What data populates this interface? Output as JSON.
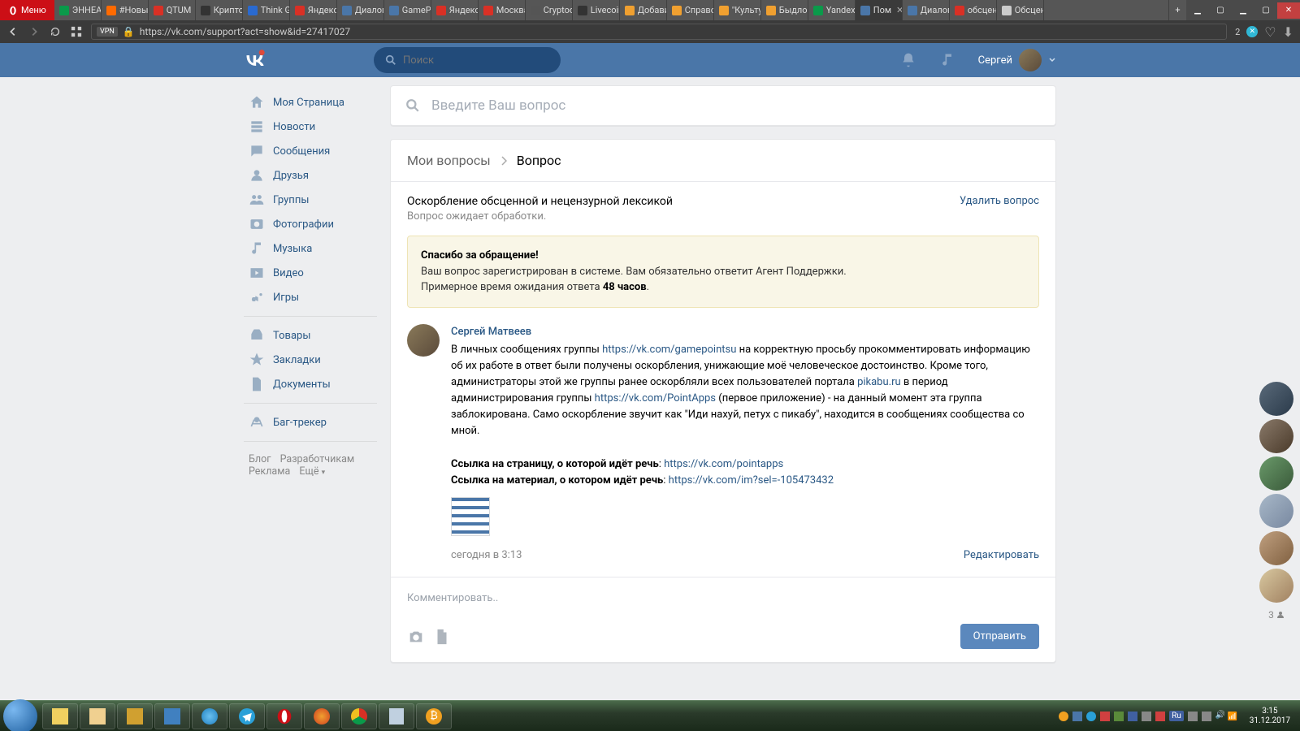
{
  "browser": {
    "menu_label": "Меню",
    "url": "https://vk.com/support?act=show&id=27417027",
    "vpn": "VPN",
    "ext_count": "2",
    "tabs": [
      {
        "label": "ЭННЕА",
        "fav": "#0a9a4a"
      },
      {
        "label": "#Новый",
        "fav": "#ff6a00"
      },
      {
        "label": "QTUM",
        "fav": "#d93025"
      },
      {
        "label": "Крипто",
        "fav": "#333"
      },
      {
        "label": "Think G",
        "fav": "#2a6ad0"
      },
      {
        "label": "Яндекс",
        "fav": "#d93025"
      },
      {
        "label": "Диалог",
        "fav": "#4a76a8"
      },
      {
        "label": "GamePo",
        "fav": "#4a76a8"
      },
      {
        "label": "Яндекс",
        "fav": "#d93025"
      },
      {
        "label": "Москва",
        "fav": "#d93025"
      },
      {
        "label": "Cryptoc",
        "fav": "#555"
      },
      {
        "label": "Livecoin",
        "fav": "#333"
      },
      {
        "label": "Добави",
        "fav": "#f0a030"
      },
      {
        "label": "Справо",
        "fav": "#f0a030"
      },
      {
        "label": "\"Культу",
        "fav": "#f0a030"
      },
      {
        "label": "Быдло|",
        "fav": "#f0a030"
      },
      {
        "label": "Yandex",
        "fav": "#0a9a4a"
      },
      {
        "label": "Пом",
        "fav": "#4a76a8",
        "active": true
      },
      {
        "label": "Диалог",
        "fav": "#4a76a8"
      },
      {
        "label": "обсцен",
        "fav": "#d93025"
      },
      {
        "label": "Обсцен",
        "fav": "#ccc"
      }
    ]
  },
  "header": {
    "search_placeholder": "Поиск",
    "user_name": "Сергей"
  },
  "sidebar": {
    "items": [
      "Моя Страница",
      "Новости",
      "Сообщения",
      "Друзья",
      "Группы",
      "Фотографии",
      "Музыка",
      "Видео",
      "Игры"
    ],
    "items2": [
      "Товары",
      "Закладки",
      "Документы"
    ],
    "items3": [
      "Баг-трекер"
    ],
    "links": {
      "blog": "Блог",
      "dev": "Разработчикам",
      "ads": "Реклама",
      "more": "Ещё"
    }
  },
  "support": {
    "search_placeholder": "Введите Ваш вопрос",
    "breadcrumb_link": "Мои вопросы",
    "breadcrumb_current": "Вопрос",
    "ticket_title": "Оскорбление обсценной и нецензурной лексикой",
    "ticket_status": "Вопрос ожидает обработки.",
    "delete": "Удалить вопрос",
    "notice_title": "Спасибо за обращение!",
    "notice_line1": "Ваш вопрос зарегистрирован в системе. Вам обязательно ответит Агент Поддержки.",
    "notice_line2_a": "Примерное время ожидания ответа ",
    "notice_line2_b": "48 часов",
    "author": "Сергей Матвеев",
    "body_1": "В личных сообщениях группы ",
    "link1": "https://vk.com/gamepointsu",
    "body_2": " на корректную просьбу прокомментировать информацию об их работе в ответ были получены оскорбления, унижающие моё человеческое достоинство. Кроме того, администраторы этой же группы ранее оскорбляли всех пользователей портала ",
    "link2": "pikabu.ru",
    "body_3": " в период администрирования группы ",
    "link3": "https://vk.com/PointApps",
    "body_4": " (первое приложение) - на данный момент эта группа заблокирована. Само оскорбление звучит как \"Иди нахуй, петух с пикабу\", находится в сообщениях сообщества со мной.",
    "ref_page_label": "Ссылка на страницу, о которой идёт речь",
    "ref_page_link": "https://vk.com/pointapps",
    "ref_mat_label": "Ссылка на материал, о котором идёт речь",
    "ref_mat_link": "https://vk.com/im?sel=-105473432",
    "timestamp": "сегодня в 3:13",
    "edit": "Редактировать",
    "comment_placeholder": "Комментировать..",
    "send": "Отправить"
  },
  "rail": {
    "count": "3"
  },
  "taskbar": {
    "time": "3:15",
    "date": "31.12.2017",
    "lang": "Ru"
  }
}
